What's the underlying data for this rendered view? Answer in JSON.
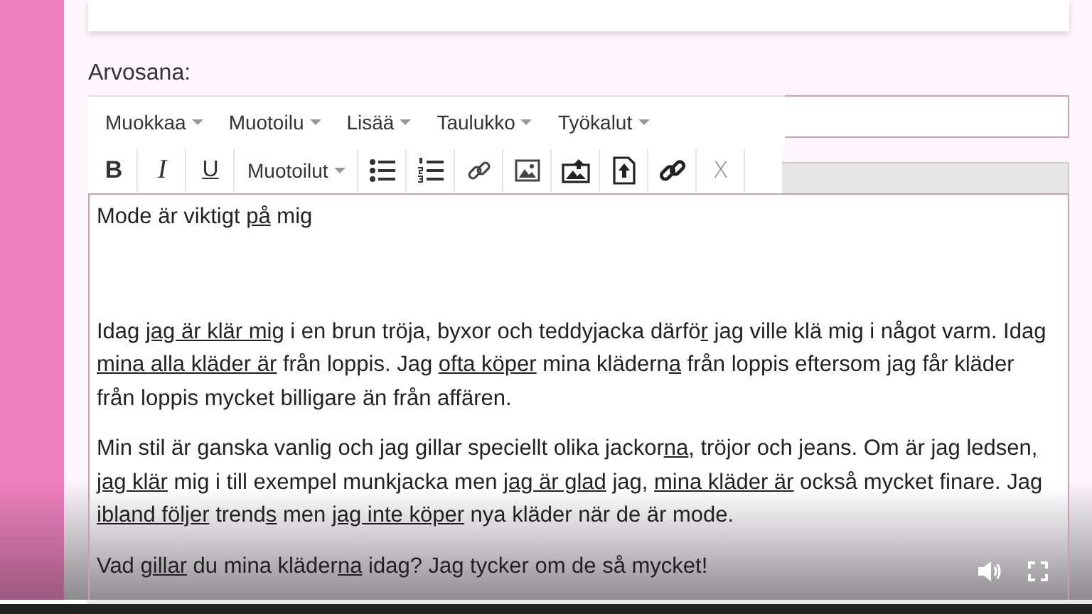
{
  "form": {
    "grade_label": "Arvosana:"
  },
  "editor": {
    "menus": [
      {
        "label": "Muokkaa"
      },
      {
        "label": "Muotoilu"
      },
      {
        "label": "Lisää"
      },
      {
        "label": "Taulukko"
      },
      {
        "label": "Työkalut"
      }
    ],
    "toolbar": [
      {
        "kind": "bold",
        "label": "B"
      },
      {
        "kind": "italic",
        "label": "I"
      },
      {
        "kind": "underline",
        "label": "U"
      },
      {
        "kind": "dropdown",
        "label": "Muotoilut"
      },
      {
        "kind": "bullets"
      },
      {
        "kind": "numbers"
      },
      {
        "kind": "link"
      },
      {
        "kind": "image"
      },
      {
        "kind": "imageupload"
      },
      {
        "kind": "fileupload"
      },
      {
        "kind": "boldlink"
      },
      {
        "kind": "clear",
        "label": "X"
      }
    ],
    "paragraphs": [
      {
        "segments": [
          {
            "text": "Mode är viktigt ",
            "underline": false
          },
          {
            "text": "på",
            "underline": true
          },
          {
            "text": " mig",
            "underline": false
          }
        ]
      },
      {
        "segments": [
          {
            "text": "Idag ",
            "underline": false
          },
          {
            "text": "jag är klär mig",
            "underline": true
          },
          {
            "text": " i en brun tröja, byxor och teddyjacka därfö",
            "underline": false
          },
          {
            "text": "r",
            "underline": true
          },
          {
            "text": " jag ville klä mig i något varm. Idag ",
            "underline": false
          },
          {
            "text": "mina alla kläder är",
            "underline": true
          },
          {
            "text": " från loppis. Jag ",
            "underline": false
          },
          {
            "text": "ofta köper",
            "underline": true
          },
          {
            "text": " mina klädern",
            "underline": false
          },
          {
            "text": "a",
            "underline": true
          },
          {
            "text": " från loppis eftersom jag får kläder från loppis mycket billigare än från affären.",
            "underline": false
          }
        ]
      },
      {
        "segments": [
          {
            "text": "Min stil är ganska vanlig och jag gillar speciellt olika jackor",
            "underline": false
          },
          {
            "text": "na",
            "underline": true
          },
          {
            "text": ", tröjor och jeans. Om är jag ledsen",
            "underline": false
          },
          {
            "text": ", jag klär",
            "underline": true
          },
          {
            "text": " mig i till exempel munkjacka men ",
            "underline": false
          },
          {
            "text": "jag är glad",
            "underline": true
          },
          {
            "text": " jag, ",
            "underline": false
          },
          {
            "text": "mina kläder är",
            "underline": true
          },
          {
            "text": " också mycket finare. Jag ",
            "underline": false
          },
          {
            "text": "ibland följer",
            "underline": true
          },
          {
            "text": " trend",
            "underline": false
          },
          {
            "text": "s",
            "underline": true
          },
          {
            "text": " men ",
            "underline": false
          },
          {
            "text": "jag inte köper",
            "underline": true
          },
          {
            "text": " nya kläder när de är mode.",
            "underline": false
          }
        ]
      },
      {
        "segments": [
          {
            "text": "Vad ",
            "underline": false
          },
          {
            "text": "gillar",
            "underline": true
          },
          {
            "text": " du mina kläder",
            "underline": false
          },
          {
            "text": "na",
            "underline": true
          },
          {
            "text": " idag? Jag tycker om de så mycket!",
            "underline": false
          }
        ]
      }
    ]
  },
  "video": {
    "progress": {
      "level": 0.08
    }
  }
}
